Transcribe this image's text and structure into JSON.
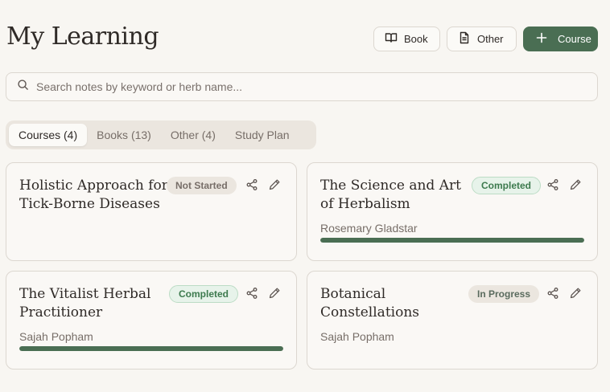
{
  "header": {
    "title": "My Learning",
    "buttons": {
      "book": "Book",
      "other": "Other",
      "course": "Course"
    }
  },
  "search": {
    "placeholder": "Search notes by keyword or herb name...",
    "value": ""
  },
  "tabs": [
    {
      "label": "Courses (4)",
      "active": true
    },
    {
      "label": "Books (13)",
      "active": false
    },
    {
      "label": "Other (4)",
      "active": false
    },
    {
      "label": "Study Plan",
      "active": false
    }
  ],
  "cards": [
    {
      "title": "Holistic Approach for Tick-Borne Diseases",
      "status": "Not Started",
      "author": "",
      "progress": null
    },
    {
      "title": "The Science and Art of Herbalism",
      "status": "Completed",
      "author": "Rosemary Gladstar",
      "progress": 1.0
    },
    {
      "title": "The Vitalist Herbal Practitioner",
      "status": "Completed",
      "author": "Sajah Popham",
      "progress": 1.0
    },
    {
      "title": "Botanical Constellations",
      "status": "In Progress",
      "author": "Sajah Popham",
      "progress": null
    }
  ],
  "colors": {
    "accent": "#4a6e53",
    "background": "#f8f6f2",
    "completed_badge": "#e7f3ea"
  },
  "icons": {
    "book": "book-open-icon",
    "other": "document-icon",
    "course": "plus-icon",
    "search": "search-icon",
    "share": "share-icon",
    "edit": "pencil-icon"
  }
}
